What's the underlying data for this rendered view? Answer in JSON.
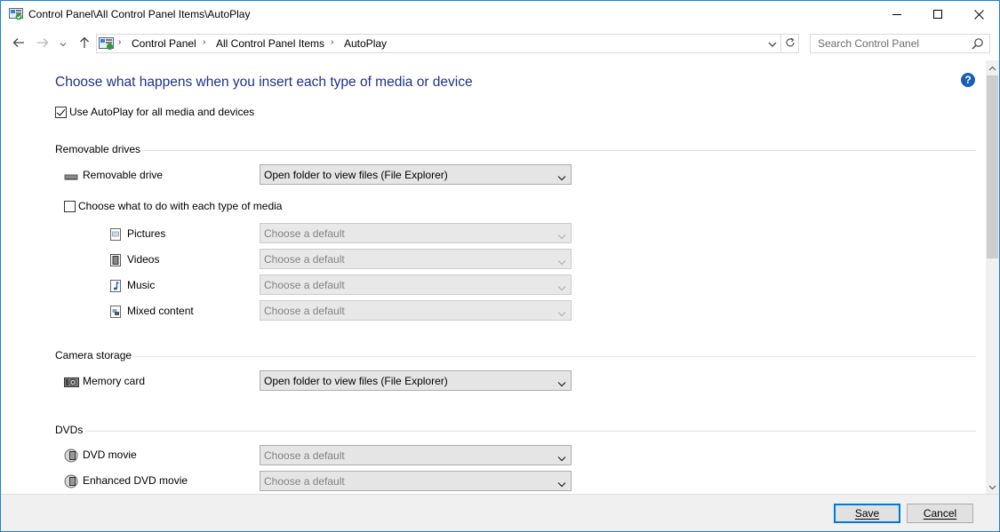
{
  "window": {
    "title": "Control Panel\\All Control Panel Items\\AutoPlay"
  },
  "navigation": {
    "breadcrumbs": [
      "Control Panel",
      "All Control Panel Items",
      "AutoPlay"
    ],
    "search_placeholder": "Search Control Panel"
  },
  "page": {
    "heading": "Choose what happens when you insert each type of media or device",
    "use_autoplay_label": "Use AutoPlay for all media and devices",
    "use_autoplay_checked": true
  },
  "removable_drives": {
    "section_title": "Removable drives",
    "drive_label": "Removable drive",
    "drive_value": "Open folder to view files (File Explorer)",
    "choose_each_label": "Choose what to do with each type of media",
    "choose_each_checked": false,
    "media_types": [
      {
        "label": "Pictures",
        "value": "Choose a default",
        "icon": "pictures-icon"
      },
      {
        "label": "Videos",
        "value": "Choose a default",
        "icon": "videos-icon"
      },
      {
        "label": "Music",
        "value": "Choose a default",
        "icon": "music-icon"
      },
      {
        "label": "Mixed content",
        "value": "Choose a default",
        "icon": "mixed-content-icon"
      }
    ]
  },
  "camera_storage": {
    "section_title": "Camera storage",
    "memory_card_label": "Memory card",
    "memory_card_value": "Open folder to view files (File Explorer)"
  },
  "dvds": {
    "section_title": "DVDs",
    "items": [
      {
        "label": "DVD movie",
        "value": "Choose a default"
      },
      {
        "label": "Enhanced DVD movie",
        "value": "Choose a default"
      }
    ]
  },
  "footer": {
    "save_label": "Save",
    "cancel_label": "Cancel"
  },
  "colors": {
    "heading": "#1e3287",
    "window_border": "#1883d7",
    "help_icon": "#1a5fb4"
  }
}
